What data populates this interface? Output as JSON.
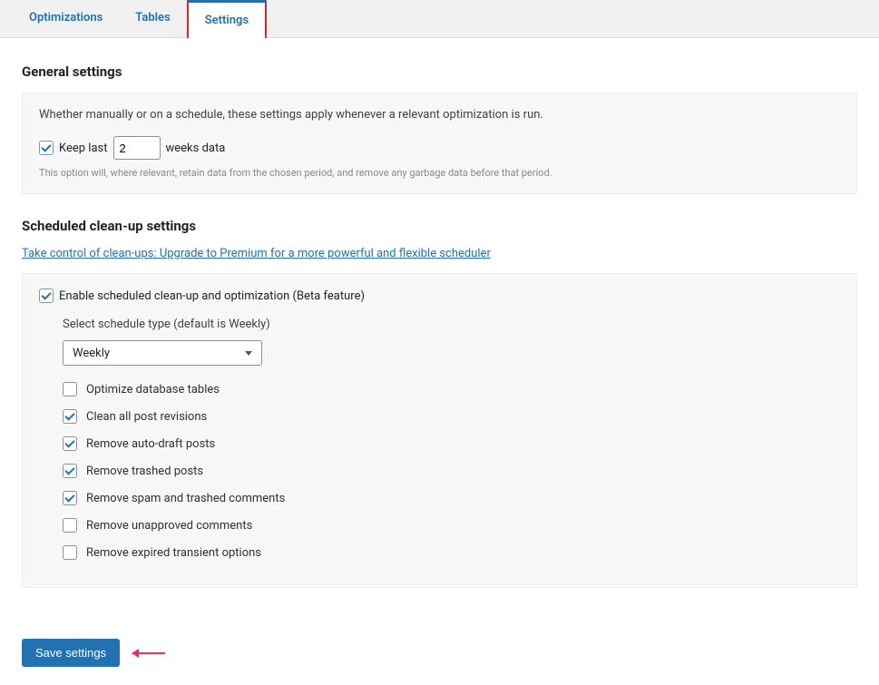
{
  "tabs": {
    "optimizations": "Optimizations",
    "tables": "Tables",
    "settings": "Settings"
  },
  "general": {
    "heading": "General settings",
    "intro": "Whether manually or on a schedule, these settings apply whenever a relevant optimization is run.",
    "keep_checked": true,
    "keep_prefix": "Keep last",
    "keep_value": "2",
    "keep_suffix": "weeks data",
    "hint": "This option will, where relevant, retain data from the chosen period, and remove any garbage data before that period."
  },
  "scheduled": {
    "heading": "Scheduled clean-up settings",
    "upgrade_link": "Take control of clean-ups: Upgrade to Premium for a more powerful and flexible scheduler",
    "enable_label": "Enable scheduled clean-up and optimization (Beta feature)",
    "enable_checked": true,
    "schedule_label": "Select schedule type (default is Weekly)",
    "schedule_value": "Weekly",
    "options": [
      {
        "label": "Optimize database tables",
        "checked": false
      },
      {
        "label": "Clean all post revisions",
        "checked": true
      },
      {
        "label": "Remove auto-draft posts",
        "checked": true
      },
      {
        "label": "Remove trashed posts",
        "checked": true
      },
      {
        "label": "Remove spam and trashed comments",
        "checked": true
      },
      {
        "label": "Remove unapproved comments",
        "checked": false
      },
      {
        "label": "Remove expired transient options",
        "checked": false
      }
    ]
  },
  "footer": {
    "save_button": "Save settings"
  }
}
